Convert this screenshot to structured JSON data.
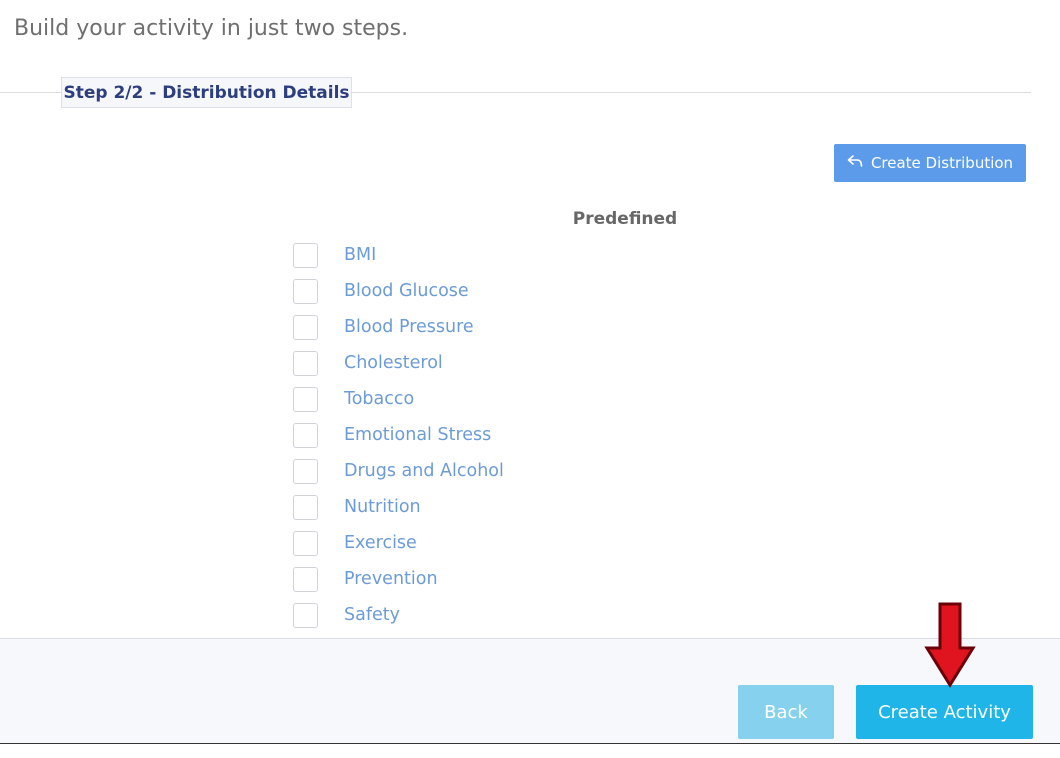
{
  "header": {
    "subtitle": "Build your activity in just two steps."
  },
  "step": {
    "legend": "Step 2/2 - Distribution Details"
  },
  "toolbar": {
    "create_distribution_label": "Create Distribution",
    "create_distribution_icon": "reply-arrow-icon"
  },
  "predefined": {
    "heading": "Predefined",
    "options": [
      {
        "label": "BMI",
        "checked": false
      },
      {
        "label": "Blood Glucose",
        "checked": false
      },
      {
        "label": "Blood Pressure",
        "checked": false
      },
      {
        "label": "Cholesterol",
        "checked": false
      },
      {
        "label": "Tobacco",
        "checked": false
      },
      {
        "label": "Emotional Stress",
        "checked": false
      },
      {
        "label": "Drugs and Alcohol",
        "checked": false
      },
      {
        "label": "Nutrition",
        "checked": false
      },
      {
        "label": "Exercise",
        "checked": false
      },
      {
        "label": "Prevention",
        "checked": false
      },
      {
        "label": "Safety",
        "checked": false
      }
    ]
  },
  "footer": {
    "back_label": "Back",
    "create_activity_label": "Create Activity"
  },
  "colors": {
    "accent": "#1fb5e8",
    "accent_light": "#86d1ee",
    "create_distribution": "#5b9bea",
    "option_label": "#6d9bd6",
    "legend_text": "#2c3e7e",
    "annotation_arrow": "#e0141e"
  }
}
